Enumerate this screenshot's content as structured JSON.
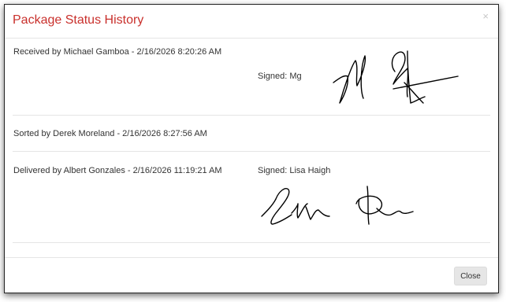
{
  "dialog": {
    "title": "Package Status History",
    "close_icon": "×",
    "close_button_label": "Close"
  },
  "history": [
    {
      "text": "Received by Michael Gamboa - 2/16/2026 8:20:26 AM",
      "signed_label": "Signed: Mg",
      "signature": "handwritten-signature"
    },
    {
      "text": "Sorted by Derek Moreland - 2/16/2026 8:27:56 AM"
    },
    {
      "text": "Delivered by Albert Gonzales - 2/16/2026 11:19:21 AM",
      "signed_label": "Signed: Lisa Haigh",
      "signature": "handwritten-signature"
    }
  ],
  "colors": {
    "title": "#c9302c",
    "divider": "#e5e5e5",
    "button_bg": "#e6e6e6"
  }
}
